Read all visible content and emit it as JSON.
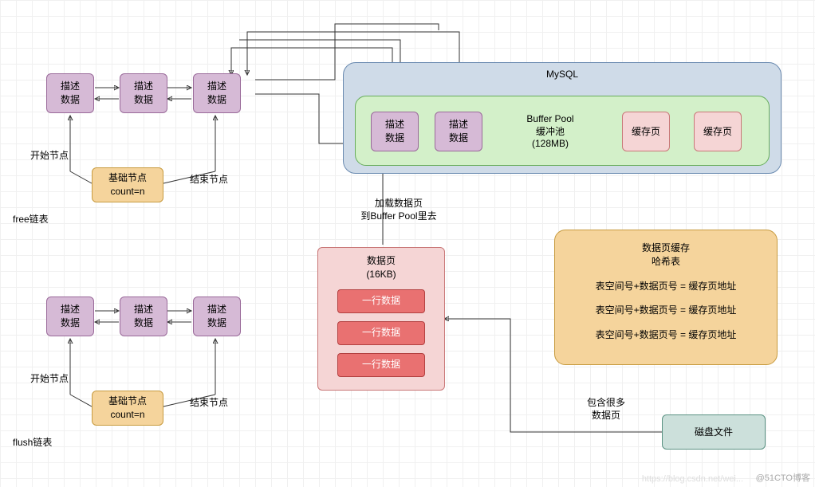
{
  "linkedLists": {
    "descDataLabel": "描述\n数据",
    "baseNodeLabel": "基础节点\ncount=n",
    "startNodeLabel": "开始节点",
    "endNodeLabel": "结束节点",
    "freeListLabel": "free链表",
    "flushListLabel": "flush链表"
  },
  "mysql": {
    "title": "MySQL",
    "bufferPoolLabel": "Buffer Pool\n缓冲池\n(128MB)",
    "descDataLabel": "描述\n数据",
    "cachePageLabel": "缓存页"
  },
  "dataPage": {
    "title": "数据页\n(16KB)",
    "rowLabel": "一行数据",
    "loadLabel": "加载数据页\n到Buffer Pool里去"
  },
  "hashTable": {
    "title": "数据页缓存\n哈希表",
    "entry": "表空间号+数据页号 = 缓存页地址"
  },
  "disk": {
    "label": "磁盘文件",
    "containsLabel": "包含很多\n数据页"
  },
  "watermark": {
    "site": "@51CTO博客",
    "csdn": "https://blog.csdn.net/wei..."
  }
}
